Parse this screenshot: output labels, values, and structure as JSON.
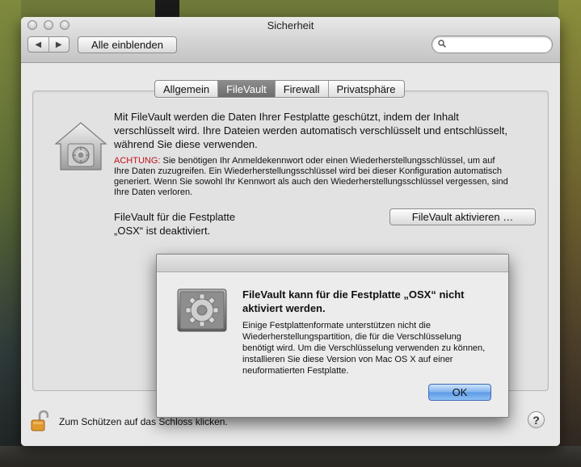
{
  "window": {
    "title": "Sicherheit",
    "back_label": "◀",
    "forward_label": "▶",
    "show_all_label": "Alle einblenden",
    "search_value": "",
    "search_placeholder": ""
  },
  "tabs": [
    {
      "label": "Allgemein",
      "selected": false
    },
    {
      "label": "FileVault",
      "selected": true
    },
    {
      "label": "Firewall",
      "selected": false
    },
    {
      "label": "Privatsphäre",
      "selected": false
    }
  ],
  "filevault": {
    "description": "Mit FileVault werden die Daten Ihrer Festplatte geschützt, indem der Inhalt verschlüsselt wird. Ihre Dateien werden automatisch verschlüsselt und entschlüsselt, während Sie diese verwenden.",
    "warning_label": "ACHTUNG:",
    "warning_text": " Sie benötigen Ihr Anmeldekennwort oder einen Wiederherstellungsschlüssel, um auf Ihre Daten zuzugreifen. Ein Wiederherstellungsschlüssel wird bei dieser Konfiguration automatisch generiert. Wenn Sie sowohl Ihr Kennwort als auch den Wiederherstellungsschlüssel vergessen, sind Ihre Daten verloren.",
    "status_line1": "FileVault für die Festplatte",
    "status_line2": "„OSX“ ist deaktiviert.",
    "activate_label": "FileVault aktivieren …"
  },
  "footer": {
    "lock_label": "Zum Schützen auf das Schloss klicken.",
    "help_label": "?"
  },
  "dialog": {
    "title": "FileVault kann für die Festplatte „OSX“ nicht aktiviert werden.",
    "body": "Einige Festplattenformate unterstützen nicht die Wiederherstellungspartition, die für die Verschlüsselung benötigt wird. Um die Verschlüsselung verwenden zu können, installieren Sie diese Version von Mac OS X auf einer neuformatierten Festplatte.",
    "ok_label": "OK"
  },
  "colors": {
    "warning_red": "#c1121b",
    "ok_button_blue": "#5b98e6",
    "selected_tab": "#7a7a7a"
  },
  "icons": {
    "filevault": "filevault-house-safe-icon",
    "dialog": "system-preferences-gear-icon",
    "lock": "open-padlock-icon",
    "search": "magnifier-icon"
  }
}
